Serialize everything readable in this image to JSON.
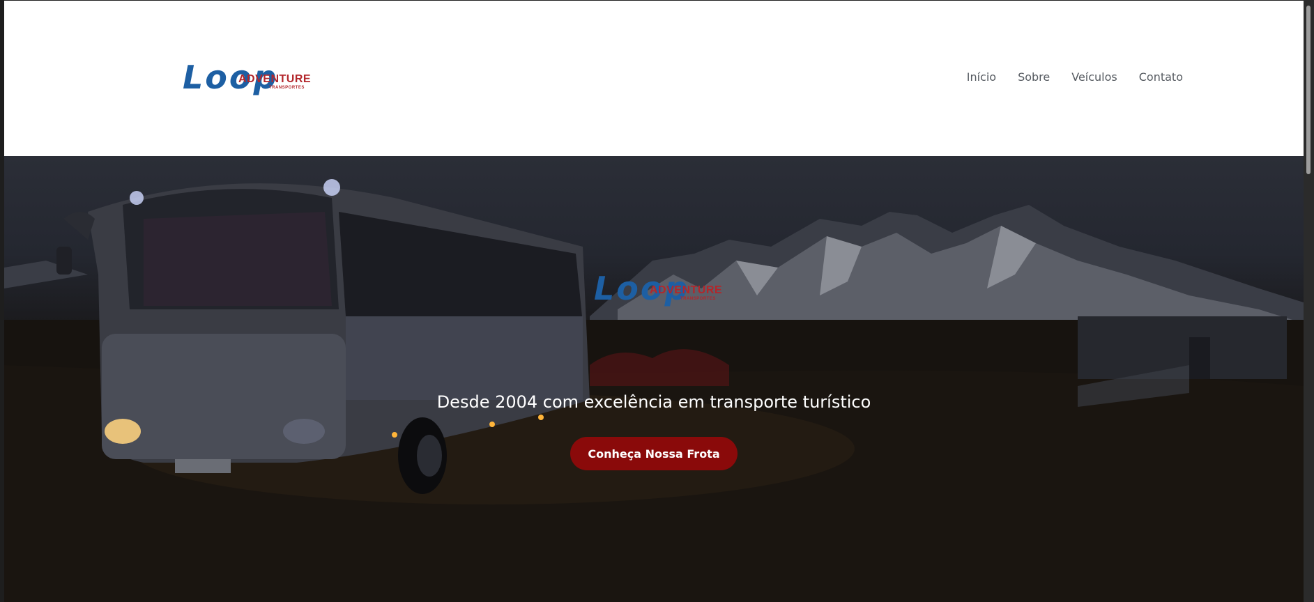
{
  "header": {
    "logo": {
      "main": "Loop",
      "word": "ADVENTURE",
      "sub": "TRANSPORTES"
    },
    "nav": [
      {
        "label": "Início"
      },
      {
        "label": "Sobre"
      },
      {
        "label": "Veículos"
      },
      {
        "label": "Contato"
      }
    ]
  },
  "hero": {
    "logo": {
      "main": "Loop",
      "word": "ADVENTURE",
      "sub": "TRANSPORTES"
    },
    "tagline": "Desde 2004 com excelência em transporte turístico",
    "cta_label": "Conheça Nossa Frota",
    "background_image": "bus-at-night-with-snowy-mountains"
  },
  "colors": {
    "brand_blue": "#1d5fa3",
    "brand_red": "#b3262b",
    "cta": "#8a0a0a",
    "nav_text": "#555a60"
  }
}
